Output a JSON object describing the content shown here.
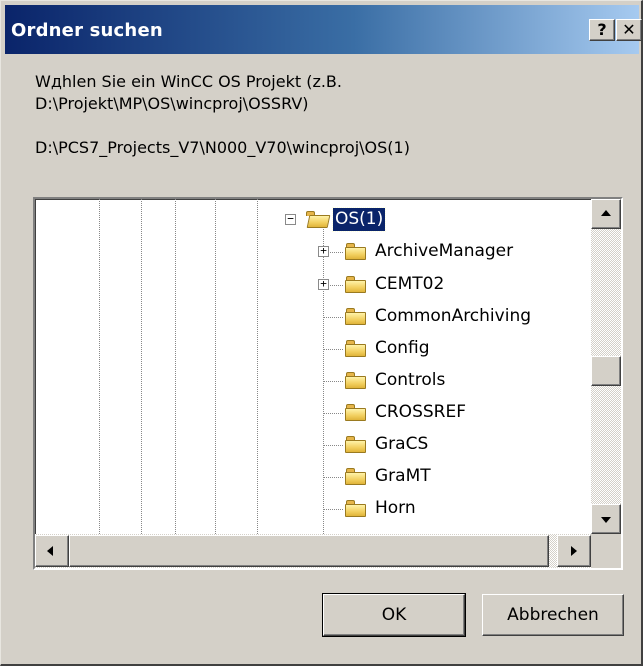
{
  "dialog": {
    "title": "Ordner suchen",
    "help_label": "?",
    "close_label": "✕",
    "description": "Wдhlen Sie ein WinCC OS Projekt (z.B. D:\\Projekt\\MP\\OS\\wincproj\\OSSRV)",
    "current_path": "D:\\PCS7_Projects_V7\\N000_V70\\wincproj\\OS(1)"
  },
  "tree": {
    "selected": "OS(1)",
    "root": {
      "label": "OS(1)",
      "expanded": true,
      "icon": "folder-open-icon"
    },
    "children": [
      {
        "label": "ArchiveManager",
        "expandable": true,
        "icon": "folder-icon"
      },
      {
        "label": "CEMT02",
        "expandable": true,
        "icon": "folder-icon"
      },
      {
        "label": "CommonArchiving",
        "expandable": false,
        "icon": "folder-icon"
      },
      {
        "label": "Config",
        "expandable": false,
        "icon": "folder-icon"
      },
      {
        "label": "Controls",
        "expandable": false,
        "icon": "folder-icon"
      },
      {
        "label": "CROSSREF",
        "expandable": false,
        "icon": "folder-icon"
      },
      {
        "label": "GraCS",
        "expandable": false,
        "icon": "folder-icon"
      },
      {
        "label": "GraMT",
        "expandable": false,
        "icon": "folder-icon"
      },
      {
        "label": "Horn",
        "expandable": false,
        "icon": "folder-icon"
      }
    ]
  },
  "buttons": {
    "ok_label": "OK",
    "cancel_label": "Abbrechen"
  },
  "colors": {
    "titlebar_start": "#0a246a",
    "titlebar_end": "#a6caf0",
    "selection": "#0a246a",
    "face": "#d4d0c8"
  }
}
